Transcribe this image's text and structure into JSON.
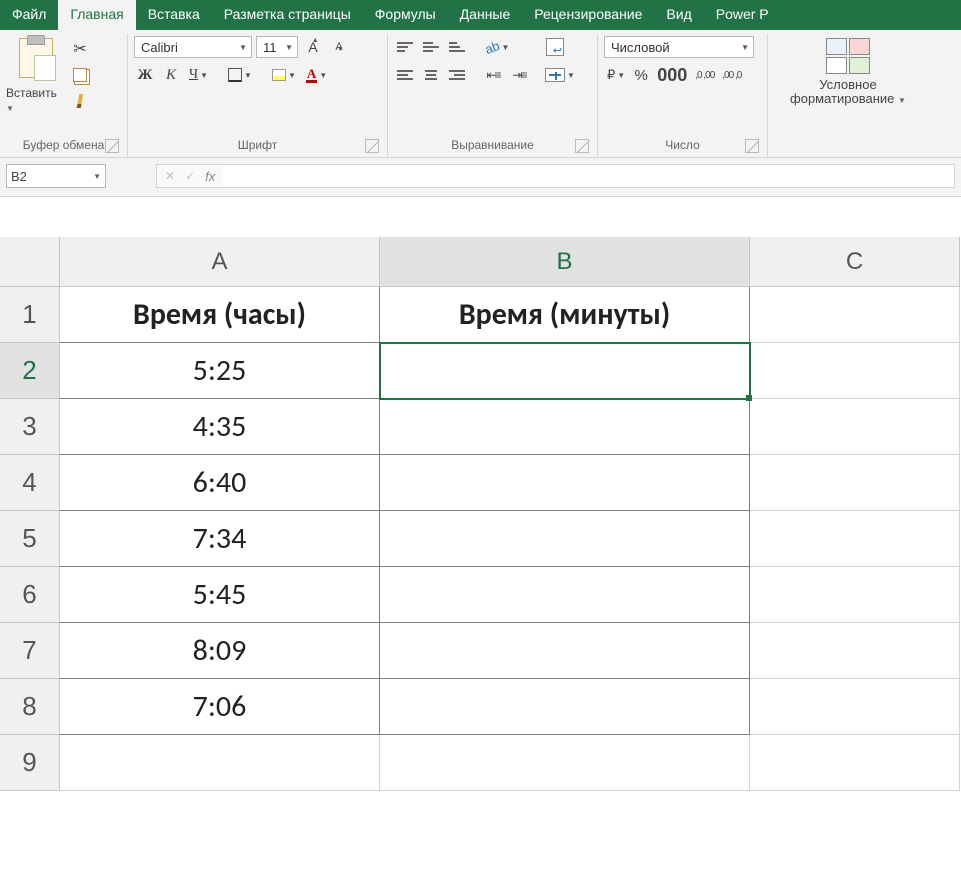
{
  "tabs": {
    "file": "Файл",
    "home": "Главная",
    "insert": "Вставка",
    "layout": "Разметка страницы",
    "formulas": "Формулы",
    "data": "Данные",
    "review": "Рецензирование",
    "view": "Вид",
    "powerp": "Power P"
  },
  "ribbon": {
    "paste": "Вставить",
    "clipboard_group": "Буфер обмена",
    "font_group": "Шрифт",
    "alignment_group": "Выравнивание",
    "number_group": "Число",
    "font_name": "Calibri",
    "font_size": "11",
    "number_format": "Числовой",
    "cond_format_l1": "Условное",
    "cond_format_l2": "форматирование",
    "bold_glyph": "Ж",
    "italic_glyph": "К",
    "underline_glyph": "Ч",
    "inc_a": "A",
    "dec_a": "A",
    "fontcolor_a": "А",
    "currency": "₽",
    "percent": "%",
    "thousands": "000",
    "dec_inc": ",0 ,00",
    "dec_dec": ",00 ,0"
  },
  "formula_bar": {
    "cell_ref": "B2",
    "cancel": "✕",
    "enter": "✓",
    "fx": "fx",
    "value": ""
  },
  "sheet": {
    "columns": [
      "A",
      "B",
      "C"
    ],
    "row_numbers": [
      "1",
      "2",
      "3",
      "4",
      "5",
      "6",
      "7",
      "8",
      "9"
    ],
    "headers": {
      "A": "Время (часы)",
      "B": "Время (минуты)"
    },
    "rows": [
      {
        "A": "5:25",
        "B": ""
      },
      {
        "A": "4:35",
        "B": ""
      },
      {
        "A": "6:40",
        "B": ""
      },
      {
        "A": "7:34",
        "B": ""
      },
      {
        "A": "5:45",
        "B": ""
      },
      {
        "A": "8:09",
        "B": ""
      },
      {
        "A": "7:06",
        "B": ""
      }
    ],
    "selected": "B2"
  }
}
